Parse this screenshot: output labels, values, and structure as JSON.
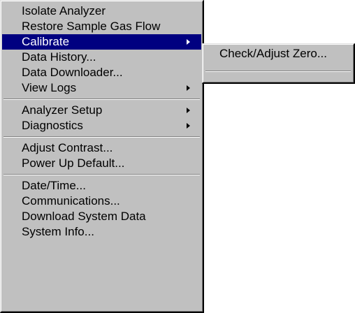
{
  "main_menu": {
    "groups": [
      {
        "items": [
          {
            "label": "Isolate Analyzer",
            "has_submenu": false
          },
          {
            "label": "Restore Sample Gas Flow",
            "has_submenu": false
          },
          {
            "label": "Calibrate",
            "has_submenu": true,
            "highlighted": true
          },
          {
            "label": "Data History...",
            "has_submenu": false
          },
          {
            "label": "Data Downloader...",
            "has_submenu": false
          },
          {
            "label": "View Logs",
            "has_submenu": true
          }
        ]
      },
      {
        "items": [
          {
            "label": "Analyzer Setup",
            "has_submenu": true
          },
          {
            "label": "Diagnostics",
            "has_submenu": true
          }
        ]
      },
      {
        "items": [
          {
            "label": "Adjust Contrast...",
            "has_submenu": false
          },
          {
            "label": "Power Up Default...",
            "has_submenu": false
          }
        ]
      },
      {
        "items": [
          {
            "label": "Date/Time...",
            "has_submenu": false
          },
          {
            "label": "Communications...",
            "has_submenu": false
          },
          {
            "label": "Download System Data",
            "has_submenu": false
          },
          {
            "label": "System Info...",
            "has_submenu": false
          }
        ]
      }
    ]
  },
  "calibrate_submenu": {
    "items": [
      {
        "label": "Check/Adjust Zero..."
      }
    ]
  },
  "colors": {
    "menu_face": "#c0c0c0",
    "highlight": "#000080",
    "highlight_text": "#ffffff"
  }
}
